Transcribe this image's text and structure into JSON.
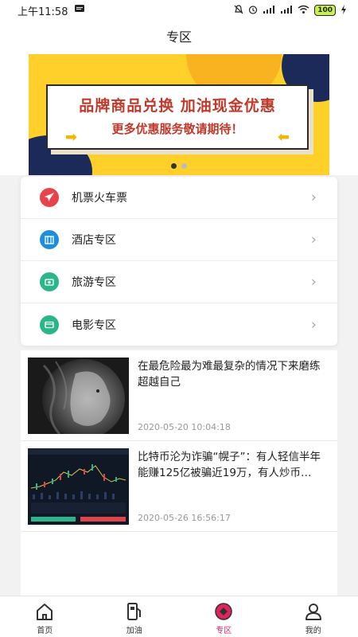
{
  "status_bar": {
    "time": "上午11:58",
    "battery": "100"
  },
  "header": {
    "title": "专区"
  },
  "banner": {
    "title": "品牌商品兑换  加油现金优惠",
    "subtitle": "更多优惠服务敬请期待！",
    "page_count": 2,
    "active_page": 1
  },
  "menu": {
    "items": [
      {
        "label": "机票火车票",
        "icon": "plane-icon",
        "color": "#e8434b"
      },
      {
        "label": "酒店专区",
        "icon": "hotel-icon",
        "color": "#1e8fd6"
      },
      {
        "label": "旅游专区",
        "icon": "travel-icon",
        "color": "#2bb58a"
      },
      {
        "label": "电影专区",
        "icon": "movie-icon",
        "color": "#2bb58a"
      }
    ]
  },
  "news": [
    {
      "title": "在最危险最为难最复杂的情况下来磨练超越自己",
      "date": "2020-05-20 10:04:18"
    },
    {
      "title": "比特币沦为诈骗“幌子”：有人轻信半年能赚125亿被骗近19万，有人炒币…",
      "date": "2020-05-26 16:56:17"
    }
  ],
  "tabbar": {
    "tabs": [
      {
        "label": "首页"
      },
      {
        "label": "加油"
      },
      {
        "label": "专区"
      },
      {
        "label": "我的"
      }
    ],
    "active_color": "#e0245e"
  }
}
